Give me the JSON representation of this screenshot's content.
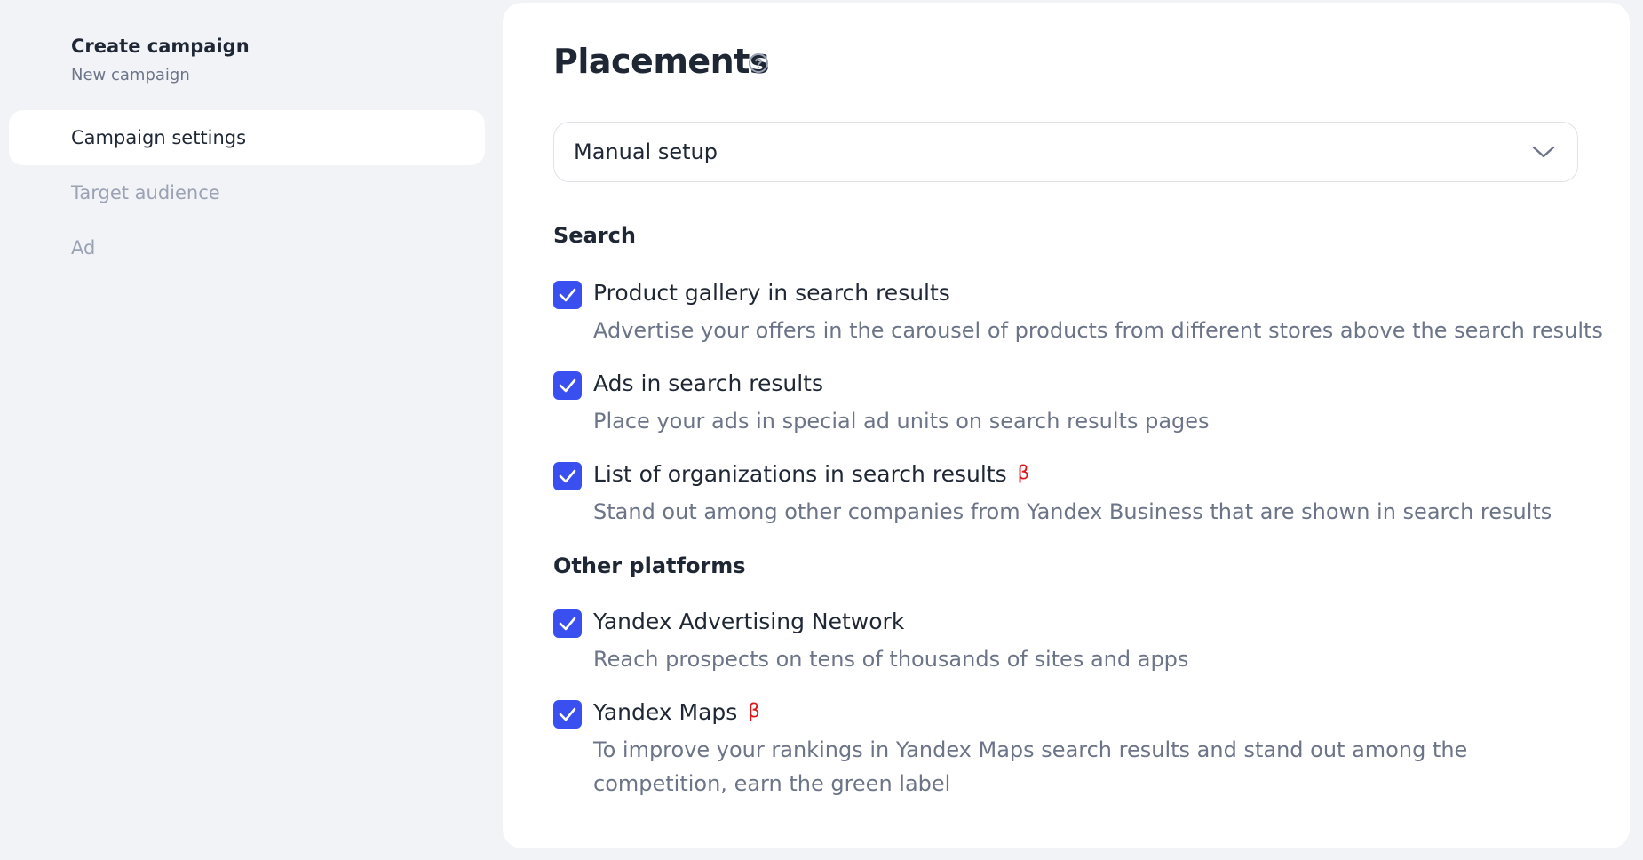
{
  "sidebar": {
    "title": "Create campaign",
    "subtitle": "New campaign",
    "items": [
      {
        "label": "Campaign settings",
        "active": true
      },
      {
        "label": "Target audience",
        "active": false
      },
      {
        "label": "Ad",
        "active": false
      }
    ]
  },
  "main": {
    "title": "Placements",
    "help_icon": "question-circle-icon",
    "setup_select": {
      "value": "Manual setup",
      "icon": "chevron-down-icon"
    },
    "sections": [
      {
        "title": "Search",
        "options": [
          {
            "label": "Product gallery in search results",
            "description": "Advertise your offers in the carousel of products from different stores above the search results",
            "checked": true,
            "beta": ""
          },
          {
            "label": "Ads in search results",
            "description": "Place your ads in special ad units on search results pages",
            "checked": true,
            "beta": ""
          },
          {
            "label": "List of organizations in search results",
            "description": "Stand out among other companies from Yandex Business that are shown in search results",
            "checked": true,
            "beta": "β"
          }
        ]
      },
      {
        "title": "Other platforms",
        "options": [
          {
            "label": "Yandex Advertising Network",
            "description": "Reach prospects on tens of thousands of sites and apps",
            "checked": true,
            "beta": ""
          },
          {
            "label": "Yandex Maps",
            "description": "To improve your rankings in Yandex Maps search results and stand out among the competition, earn the green label",
            "checked": true,
            "beta": "β"
          }
        ]
      }
    ]
  },
  "colors": {
    "accent": "#3a4ff0",
    "beta": "#e0161b",
    "background": "#f1f3f7",
    "text_primary": "#1f2735",
    "text_secondary": "#6c7488",
    "text_disabled": "#9aa2b3"
  }
}
